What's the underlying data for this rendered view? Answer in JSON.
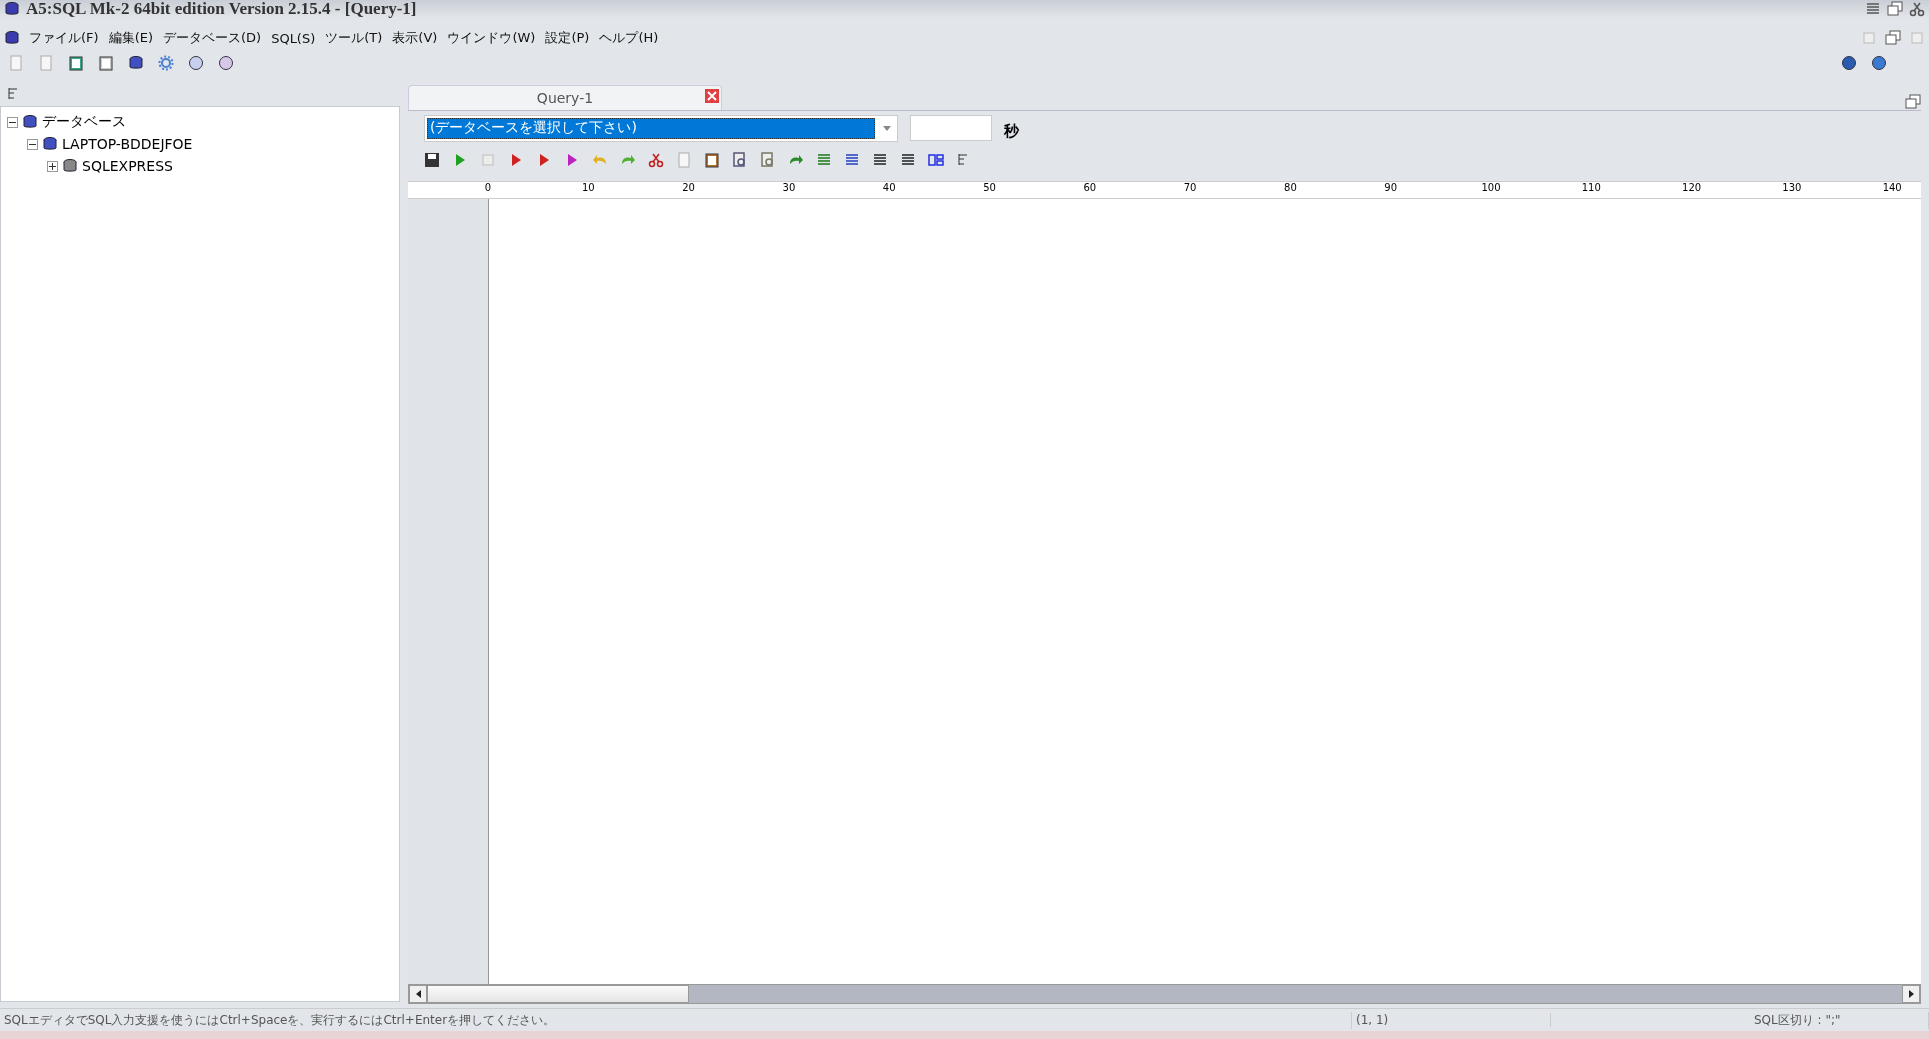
{
  "window": {
    "title": "A5:SQL Mk-2 64bit edition Version 2.15.4 - [Query-1]"
  },
  "menu": [
    "ファイル(F)",
    "編集(E)",
    "データベース(D)",
    "SQL(S)",
    "ツール(T)",
    "表示(V)",
    "ウインドウ(W)",
    "設定(P)",
    "ヘルプ(H)"
  ],
  "tree": [
    {
      "label": "データベース",
      "expanded": true,
      "children": [
        {
          "label": "LAPTOP-BDDEJFOE",
          "expanded": true,
          "children": [
            {
              "label": "SQLEXPRESS",
              "expanded": false
            }
          ]
        }
      ]
    }
  ],
  "tabs": [
    {
      "label": "Query-1",
      "selected": true
    }
  ],
  "database_select": {
    "value": "(データベースを選択して下さい)"
  },
  "timeout": {
    "unit": "秒"
  },
  "ruler": [
    "0",
    "10",
    "20",
    "30",
    "40",
    "50",
    "60",
    "70",
    "80",
    "90",
    "100",
    "110",
    "120",
    "130",
    "140"
  ],
  "status_bar": {
    "message": "SQLエディタでSQL入力支援を使うにはCtrl+Spaceを、実行するにはCtrl+Enterを押してください。",
    "position": "(1, 1)",
    "delimiter": "SQL区切り : \";\""
  }
}
